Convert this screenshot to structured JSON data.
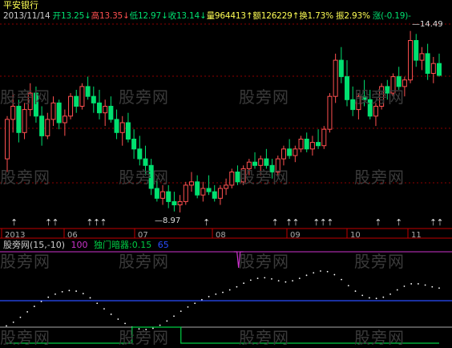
{
  "stock": {
    "name": "平安银行",
    "date": "2013/11/14",
    "open_label": "开",
    "open": "13.25",
    "open_arrow": "↓",
    "high_label": "高",
    "high": "13.35",
    "high_arrow": "↓",
    "low_label": "低",
    "low": "12.97",
    "low_arrow": "↓",
    "close_label": "收",
    "close": "13.14",
    "close_arrow": "↓",
    "volume_label": "量",
    "volume": "964413",
    "volume_arrow": "↑",
    "amount_label": "额",
    "amount": "126229",
    "amount_arrow": "↑",
    "turnover_label": "换",
    "turnover": "1.73%",
    "amplitude_label": "振",
    "amplitude": "2.93%",
    "change_label": "涨",
    "change": "(-0.19)-"
  },
  "markers": {
    "max": "14.49",
    "min": "8.97"
  },
  "date_axis": [
    "2013",
    "06",
    "07",
    "08",
    "09",
    "10",
    "11"
  ],
  "indicator": {
    "name": "股旁网",
    "params": "(15,-10)",
    "level": "100",
    "signal_label": "独门暗器:",
    "signal_value": "0.15",
    "tail": "65"
  },
  "watermark": "股旁网",
  "colors": {
    "up": "#ff5050",
    "down": "#00e070",
    "grid": "#8b0000",
    "axis": "#c00000",
    "blue": "#2a4cff",
    "magenta": "#cc33cc",
    "yellow": "#ffff55",
    "signal": "#00cc44"
  },
  "candles": [
    [
      10.6,
      11.9,
      10.2,
      11.8
    ],
    [
      11.8,
      12.6,
      11.4,
      12.2
    ],
    [
      12.2,
      12.4,
      11.1,
      11.4
    ],
    [
      11.4,
      12.3,
      11.2,
      12.1
    ],
    [
      12.1,
      12.9,
      11.9,
      12.6
    ],
    [
      12.6,
      12.8,
      11.7,
      11.9
    ],
    [
      11.9,
      12.2,
      11.0,
      11.3
    ],
    [
      11.3,
      12.0,
      11.2,
      11.8
    ],
    [
      11.8,
      12.5,
      11.6,
      12.3
    ],
    [
      12.3,
      12.4,
      11.5,
      11.7
    ],
    [
      11.7,
      12.1,
      11.3,
      11.9
    ],
    [
      11.9,
      12.6,
      11.8,
      12.5
    ],
    [
      12.5,
      12.7,
      12.0,
      12.2
    ],
    [
      12.2,
      12.9,
      12.1,
      12.8
    ],
    [
      12.8,
      13.1,
      12.4,
      12.5
    ],
    [
      12.5,
      12.8,
      12.0,
      12.3
    ],
    [
      12.3,
      12.7,
      11.8,
      12.0
    ],
    [
      12.0,
      12.4,
      11.6,
      12.2
    ],
    [
      12.2,
      12.5,
      11.7,
      11.8
    ],
    [
      11.8,
      12.1,
      11.2,
      11.4
    ],
    [
      11.4,
      11.9,
      11.0,
      11.7
    ],
    [
      11.7,
      12.0,
      11.1,
      11.2
    ],
    [
      11.2,
      11.5,
      10.6,
      10.9
    ],
    [
      10.9,
      11.3,
      10.4,
      10.6
    ],
    [
      10.6,
      11.0,
      10.1,
      10.4
    ],
    [
      10.4,
      10.6,
      9.5,
      9.7
    ],
    [
      9.7,
      10.0,
      9.3,
      9.4
    ],
    [
      9.4,
      9.8,
      9.2,
      9.6
    ],
    [
      9.6,
      9.8,
      9.1,
      9.3
    ],
    [
      9.3,
      9.6,
      9.0,
      9.2
    ],
    [
      9.2,
      9.5,
      8.97,
      9.3
    ],
    [
      9.3,
      9.9,
      9.2,
      9.8
    ],
    [
      9.8,
      10.2,
      9.6,
      9.9
    ],
    [
      9.9,
      10.1,
      9.4,
      9.5
    ],
    [
      9.5,
      9.9,
      9.3,
      9.7
    ],
    [
      9.7,
      10.1,
      9.5,
      9.6
    ],
    [
      9.6,
      9.8,
      9.3,
      9.4
    ],
    [
      9.4,
      9.8,
      9.2,
      9.7
    ],
    [
      9.7,
      10.0,
      9.5,
      9.8
    ],
    [
      9.8,
      10.3,
      9.7,
      10.2
    ],
    [
      10.2,
      10.4,
      9.8,
      9.9
    ],
    [
      9.9,
      10.4,
      9.8,
      10.3
    ],
    [
      10.3,
      10.6,
      10.1,
      10.5
    ],
    [
      10.5,
      10.8,
      10.3,
      10.4
    ],
    [
      10.4,
      10.7,
      10.1,
      10.6
    ],
    [
      10.6,
      10.9,
      10.3,
      10.4
    ],
    [
      10.4,
      10.6,
      10.0,
      10.2
    ],
    [
      10.2,
      10.7,
      10.1,
      10.6
    ],
    [
      10.6,
      11.0,
      10.4,
      10.9
    ],
    [
      10.9,
      11.2,
      10.6,
      10.7
    ],
    [
      10.7,
      11.0,
      10.5,
      10.9
    ],
    [
      10.9,
      11.3,
      10.8,
      11.2
    ],
    [
      11.2,
      11.4,
      10.8,
      10.9
    ],
    [
      10.9,
      11.3,
      10.7,
      11.1
    ],
    [
      11.1,
      11.5,
      10.9,
      11.0
    ],
    [
      11.0,
      11.6,
      10.9,
      11.5
    ],
    [
      11.5,
      12.6,
      11.4,
      12.5
    ],
    [
      12.5,
      13.8,
      12.3,
      13.6
    ],
    [
      13.6,
      14.0,
      12.9,
      13.1
    ],
    [
      13.1,
      13.6,
      12.2,
      12.4
    ],
    [
      12.4,
      12.8,
      11.9,
      12.1
    ],
    [
      12.1,
      12.6,
      11.8,
      12.5
    ],
    [
      12.5,
      13.0,
      12.2,
      12.4
    ],
    [
      12.4,
      12.7,
      11.8,
      11.9
    ],
    [
      11.9,
      12.3,
      11.6,
      12.2
    ],
    [
      12.2,
      12.9,
      12.1,
      12.8
    ],
    [
      12.8,
      13.0,
      12.4,
      12.6
    ],
    [
      12.6,
      13.2,
      12.5,
      13.1
    ],
    [
      13.1,
      13.4,
      12.7,
      12.8
    ],
    [
      12.8,
      13.1,
      12.5,
      13.0
    ],
    [
      13.0,
      14.49,
      12.9,
      14.2
    ],
    [
      14.2,
      14.4,
      13.4,
      13.6
    ],
    [
      13.6,
      14.0,
      13.3,
      13.8
    ],
    [
      13.8,
      14.1,
      13.0,
      13.2
    ],
    [
      13.2,
      13.7,
      12.9,
      13.5
    ],
    [
      13.5,
      13.8,
      13.1,
      13.14
    ]
  ],
  "osc_line": [
    0.1,
    0.16,
    0.24,
    0.33,
    0.42,
    0.5,
    0.57,
    0.62,
    0.66,
    0.68,
    0.67,
    0.63,
    0.56,
    0.47,
    0.38,
    0.29,
    0.21,
    0.14,
    0.08,
    0.05,
    0.04,
    0.06,
    0.11,
    0.18,
    0.26,
    0.34,
    0.41,
    0.47,
    0.53,
    0.58,
    0.62,
    0.65,
    0.69,
    0.74,
    0.8,
    0.85,
    0.88,
    0.89,
    0.87,
    0.84,
    0.82,
    0.84,
    0.88,
    0.93,
    0.97,
    1.0,
    0.99,
    0.94,
    0.86,
    0.76,
    0.67,
    0.6,
    0.56,
    0.55,
    0.57,
    0.62,
    0.69,
    0.75,
    0.79,
    0.79,
    0.77,
    0.74,
    0.72
  ],
  "osc_spike_index": 32,
  "osc_signal": [
    0,
    0,
    0,
    0,
    0,
    0,
    0,
    0,
    0,
    0,
    0,
    0,
    0,
    0,
    0,
    0,
    0,
    0,
    1,
    1,
    1,
    1,
    1,
    1,
    1,
    0,
    0,
    0,
    0,
    0,
    0,
    0,
    0,
    0,
    0,
    0,
    0,
    0,
    0,
    0,
    0,
    0,
    0,
    0,
    0,
    0,
    0,
    0,
    0,
    0,
    0,
    0,
    0,
    0,
    0,
    0,
    0,
    0,
    0,
    0,
    0,
    0,
    0
  ],
  "up_arrow_slots": [
    1,
    6,
    7,
    12,
    13,
    14,
    29,
    39,
    41,
    42,
    45,
    46,
    47,
    54,
    57,
    62,
    63
  ]
}
